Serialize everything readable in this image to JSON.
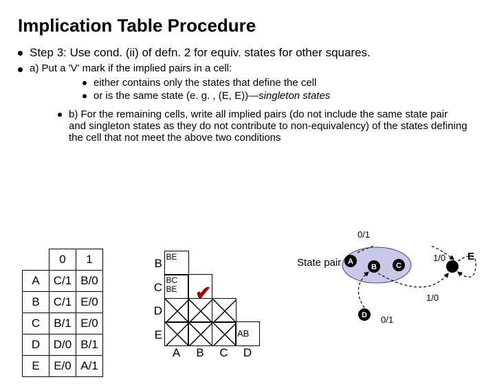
{
  "title": "Implication Table Procedure",
  "bullets": {
    "step3": "Step 3: Use cond. (ii) of defn. 2 for equiv. states for other squares.",
    "a": "a) Put a 'V' mark if the implied pairs in a cell:",
    "a1": "either contains only the states that define the cell",
    "a2_pre": "or is the same state (e. g. , (E, E))—",
    "a2_em": "singleton states",
    "b": "b) For the remaining cells, write all implied pairs (do not include the same state pair and singleton states as they do not contribute to non-equivalency) of the states defining the cell  that not meet the above two conditions"
  },
  "labels": {
    "zeroone_top": "0/1",
    "zeroone_left": "0/1",
    "oneZtop": "1/0",
    "oneZbot": "1/0",
    "statepair": "State pair"
  },
  "ttable": {
    "cols": [
      "0",
      "1"
    ],
    "rows": [
      "A",
      "B",
      "C",
      "D",
      "E"
    ],
    "cells": [
      [
        "C/1",
        "B/0"
      ],
      [
        "C/1",
        "E/0"
      ],
      [
        "B/1",
        "E/0"
      ],
      [
        "D/0",
        "B/1"
      ],
      [
        "E/0",
        "A/1"
      ]
    ]
  },
  "imptable": {
    "rowHdrs": [
      "B",
      "C",
      "D",
      "E"
    ],
    "colHdrs": [
      "A",
      "B",
      "C",
      "D"
    ],
    "BA": "BE",
    "CA": "BC\nBE",
    "ED": "AB"
  },
  "diagram": {
    "nodes": [
      "A",
      "B",
      "C",
      "D",
      "E"
    ]
  }
}
